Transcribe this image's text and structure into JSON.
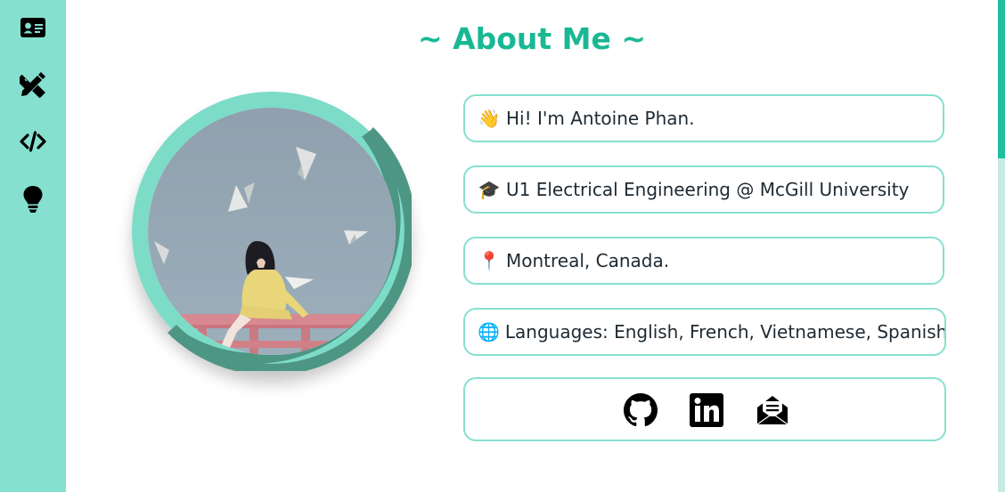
{
  "page": {
    "title": "~ About Me ~"
  },
  "sidebar": {
    "items": [
      {
        "icon": "id-card-icon"
      },
      {
        "icon": "pencil-ruler-icon"
      },
      {
        "icon": "code-icon"
      },
      {
        "icon": "lightbulb-icon"
      }
    ]
  },
  "profile": {
    "photo_description_icon": "profile-photo"
  },
  "info": [
    {
      "emoji": "👋",
      "text": "Hi! I'm Antoine Phan."
    },
    {
      "emoji": "🎓",
      "text": "U1 Electrical Engineering @ McGill University"
    },
    {
      "emoji": "📍",
      "text": "Montreal, Canada."
    },
    {
      "emoji": "🌐",
      "text": "Languages: English, French, Vietnamese, Spanish"
    }
  ],
  "socials": [
    {
      "icon": "github-icon"
    },
    {
      "icon": "linkedin-icon"
    },
    {
      "icon": "email-icon"
    }
  ],
  "colors": {
    "accent": "#19b894",
    "sidebar": "#86e0cf",
    "ring_light": "#7cdcc8",
    "ring_dark": "#4e9684"
  }
}
